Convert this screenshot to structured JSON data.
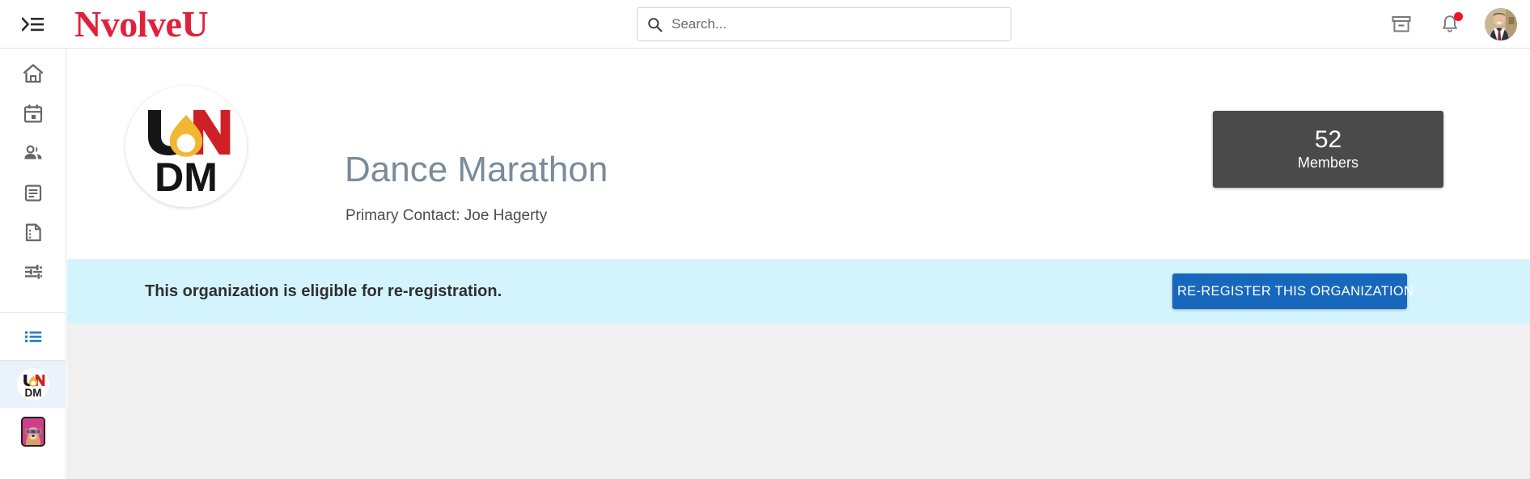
{
  "header": {
    "menu_toggle_icon": "menu-open-icon",
    "brand": "NvolveU",
    "brand_color": "#e0213b",
    "search": {
      "icon": "search-icon",
      "value": "",
      "placeholder": "Search..."
    },
    "right_icons": [
      {
        "name": "archive-inbox-icon",
        "label": "Archive"
      },
      {
        "name": "bell-icon",
        "label": "Notifications",
        "has_unread_dot": true,
        "dot_color": "#e8152b"
      },
      {
        "name": "avatar",
        "label": "User profile photo"
      }
    ]
  },
  "sidebar": {
    "items": [
      {
        "name": "sidebar-item-home",
        "icon": "home-icon",
        "label": "Home",
        "active": false
      },
      {
        "name": "sidebar-item-events",
        "icon": "calendar-icon",
        "label": "Events",
        "active": false
      },
      {
        "name": "sidebar-item-organizations",
        "icon": "people-icon",
        "label": "Organizations",
        "active": false
      },
      {
        "name": "sidebar-item-news",
        "icon": "news-article-icon",
        "label": "News",
        "active": false
      },
      {
        "name": "sidebar-item-forms",
        "icon": "form-document-icon",
        "label": "Forms",
        "active": false
      },
      {
        "name": "sidebar-item-settings",
        "icon": "sliders-settings-icon",
        "label": "Settings",
        "active": false
      }
    ],
    "lists_item": {
      "name": "sidebar-item-lists",
      "icon": "list-bullets-icon",
      "label": "Lists",
      "color": "#2a7fd4",
      "active": true
    },
    "org_shortcuts": [
      {
        "name": "sidebar-org-undm",
        "label": "UNDM Dance Marathon",
        "selected": true,
        "highlight_color": "#eaf2fb"
      },
      {
        "name": "sidebar-org-dog",
        "label": "Dog organization",
        "selected": false,
        "tile_color": "#cf3f8e"
      }
    ]
  },
  "organization": {
    "logo_alt": "UNDM logo",
    "title": "Dance Marathon",
    "primary_contact": "Primary Contact: Joe Hagerty",
    "members": {
      "count": "52",
      "label": "Members",
      "card_color": "#4a4a4a"
    }
  },
  "rereg_banner": {
    "message": "This organization is eligible for re-registration.",
    "button_label": "RE-REGISTER THIS ORGANIZATION",
    "banner_color": "#d4f4fd",
    "button_color": "#1767bd"
  }
}
